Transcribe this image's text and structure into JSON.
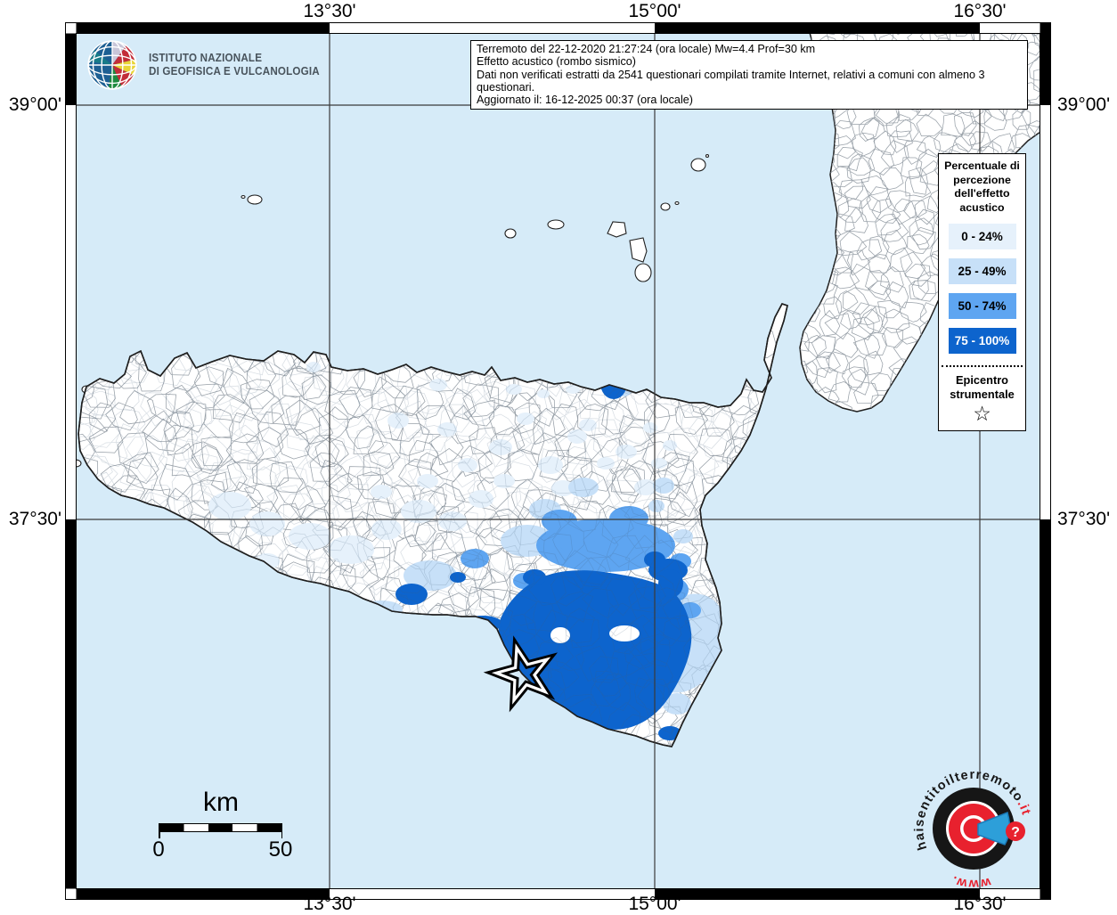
{
  "branding": {
    "institute_line1": "ISTITUTO NAZIONALE",
    "institute_line2": "DI GEOFISICA E VULCANOLOGIA"
  },
  "info_box": {
    "lines": [
      "Terremoto del 22-12-2020 21:27:24 (ora locale) Mw=4.4 Prof=30 km",
      "Effetto acustico (rombo sismico)",
      "Dati non verificati estratti da 2541 questionari compilati tramite Internet, relativi a comuni con almeno 3 questionari.",
      "Aggiornato il: 16-12-2025 00:37 (ora locale)"
    ]
  },
  "legend": {
    "title": "Percentuale di percezione dell'effetto acustico",
    "classes": [
      {
        "label": "0 - 24%",
        "color": "#e6f1fb",
        "text": "#000000"
      },
      {
        "label": "25 - 49%",
        "color": "#c7e0f8",
        "text": "#000000"
      },
      {
        "label": "50 - 74%",
        "color": "#5ea5f1",
        "text": "#000000"
      },
      {
        "label": "75 - 100%",
        "color": "#0d64cd",
        "text": "#ffffff"
      }
    ],
    "epicenter_title": "Epicentro strumentale",
    "epicenter_symbol": "☆"
  },
  "axes": {
    "meridians": [
      "13°30'",
      "15°00'",
      "16°30'"
    ],
    "parallels": [
      "39°00'",
      "37°30'"
    ]
  },
  "scale_bar": {
    "unit": "km",
    "start": "0",
    "end": "50"
  },
  "watermark": {
    "prefix": "www.",
    "main": "haisentitoilterremoto",
    "suffix": ".it",
    "badge": "?"
  },
  "map_colors": {
    "sea": "#d6ebf8",
    "land": "#ffffff",
    "coast": "#1f1f1f",
    "municipality_border": "#98a0a8",
    "grid": "#3a3a3a"
  }
}
